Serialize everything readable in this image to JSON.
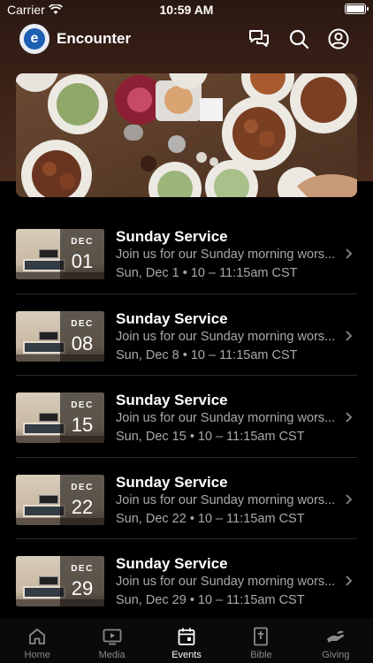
{
  "status_bar": {
    "carrier": "Carrier",
    "time": "10:59 AM"
  },
  "header": {
    "logo_letter": "e",
    "title": "Encounter",
    "icons": [
      "chat-bubbles-icon",
      "search-icon",
      "profile-icon"
    ]
  },
  "events": [
    {
      "month": "DEC",
      "day": "01",
      "title": "Sunday Service",
      "description": "Join us for our Sunday morning worship service",
      "when": "Sun, Dec 1 • 10 – 11:15am CST"
    },
    {
      "month": "DEC",
      "day": "08",
      "title": "Sunday Service",
      "description": "Join us for our Sunday morning worship service",
      "when": "Sun, Dec 8 • 10 – 11:15am CST"
    },
    {
      "month": "DEC",
      "day": "15",
      "title": "Sunday Service",
      "description": "Join us for our Sunday morning worship service",
      "when": "Sun, Dec 15 • 10 – 11:15am CST"
    },
    {
      "month": "DEC",
      "day": "22",
      "title": "Sunday Service",
      "description": "Join us for our Sunday morning worship service",
      "when": "Sun, Dec 22 • 10 – 11:15am CST"
    },
    {
      "month": "DEC",
      "day": "29",
      "title": "Sunday Service",
      "description": "Join us for our Sunday morning worship service",
      "when": "Sun, Dec 29 • 10 – 11:15am CST"
    }
  ],
  "tabs": [
    {
      "label": "Home",
      "icon": "home-icon",
      "active": false
    },
    {
      "label": "Media",
      "icon": "media-icon",
      "active": false
    },
    {
      "label": "Events",
      "icon": "calendar-icon",
      "active": true
    },
    {
      "label": "Bible",
      "icon": "bible-icon",
      "active": false
    },
    {
      "label": "Giving",
      "icon": "giving-icon",
      "active": false
    }
  ],
  "colors": {
    "background": "#000000",
    "header_gradient": "#3a2117",
    "muted_text": "#a9a9a9",
    "logo_blue": "#1c5fb3"
  }
}
